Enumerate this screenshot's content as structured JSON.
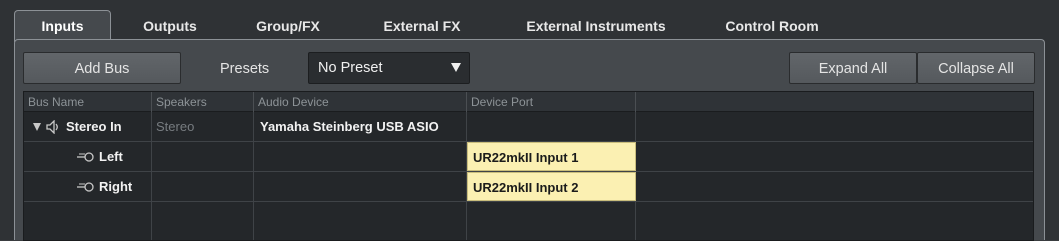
{
  "tabs": [
    {
      "label": "Inputs",
      "active": true
    },
    {
      "label": "Outputs",
      "active": false
    },
    {
      "label": "Group/FX",
      "active": false
    },
    {
      "label": "External FX",
      "active": false
    },
    {
      "label": "External Instruments",
      "active": false
    },
    {
      "label": "Control Room",
      "active": false
    }
  ],
  "toolbar": {
    "add_bus_label": "Add Bus",
    "presets_label": "Presets",
    "preset_value": "No Preset",
    "expand_all_label": "Expand All",
    "collapse_all_label": "Collapse All"
  },
  "table": {
    "columns": [
      "Bus Name",
      "Speakers",
      "Audio Device",
      "Device Port"
    ],
    "rows": [
      {
        "name": "Stereo In",
        "speakers": "Stereo",
        "audio_device": "Yamaha Steinberg USB ASIO",
        "device_port": "",
        "expanded": true,
        "icon": "speaker-icon"
      },
      {
        "name": "Left",
        "speakers": "",
        "audio_device": "",
        "device_port": "UR22mkII Input 1",
        "icon": "mono-channel-icon"
      },
      {
        "name": "Right",
        "speakers": "",
        "audio_device": "",
        "device_port": "UR22mkII Input 2",
        "icon": "mono-channel-icon"
      }
    ]
  },
  "colors": {
    "panel": "#45494d",
    "table_bg": "#24272a",
    "port_highlight": "#fbf0b2"
  }
}
